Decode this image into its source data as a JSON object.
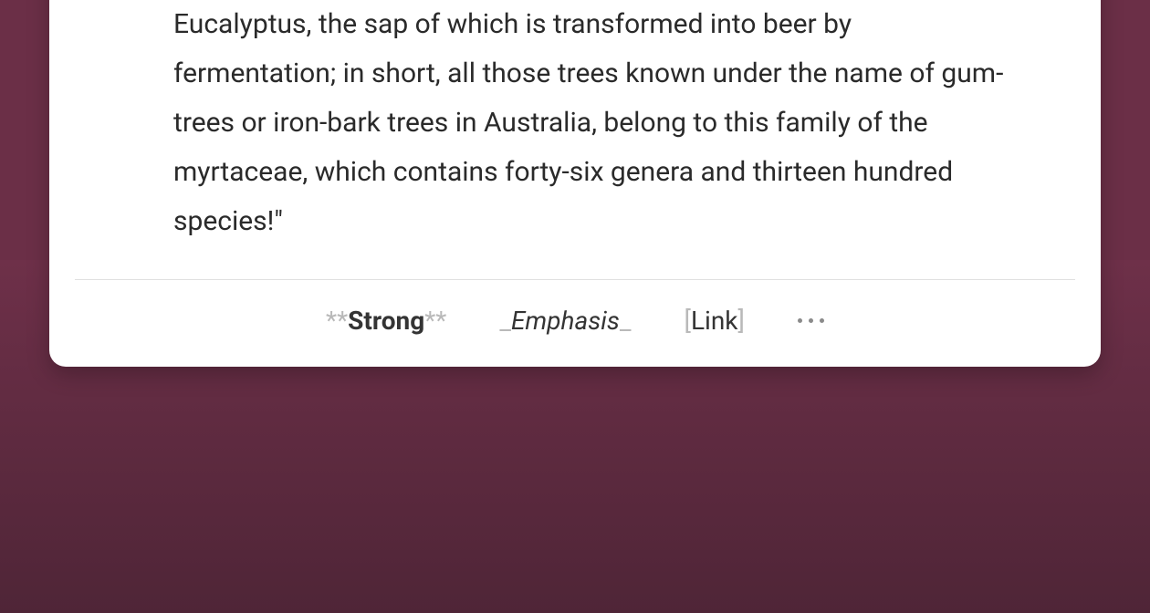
{
  "content": {
    "paragraph": "Eucalyptus, the sap of which is transformed into beer by fermentation; in short, all those trees known under the name of gum-trees or iron-bark trees in Australia, belong to this family of the myrtaceae, which contains forty-six genera and thirteen hundred species!\""
  },
  "toolbar": {
    "strong": {
      "prefix": "**",
      "label": "Strong",
      "suffix": "**"
    },
    "emphasis": {
      "prefix": "_",
      "label": "Emphasis",
      "suffix": "_"
    },
    "link": {
      "prefix": "[",
      "label": "Link",
      "suffix": "]"
    },
    "more_icon": "more-horizontal"
  }
}
